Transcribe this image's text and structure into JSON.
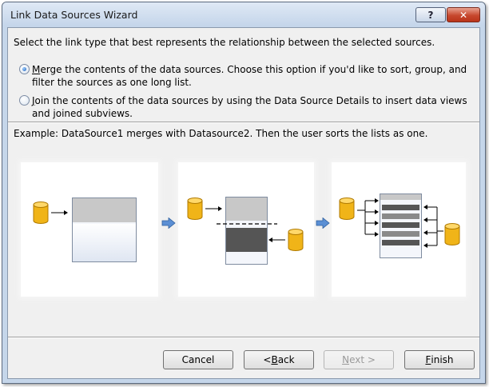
{
  "window": {
    "title": "Link Data Sources Wizard"
  },
  "titlebar": {
    "help_label": "?",
    "close_label": "✕"
  },
  "instruction": "Select the link type that best represents the relationship between the selected sources.",
  "options": [
    {
      "selected": true,
      "access_key": "M",
      "label_rest": "erge the contents of the data sources. Choose this option if you'd like to sort, group, and filter the sources as one long list."
    },
    {
      "selected": false,
      "access_key": "J",
      "label_rest": "oin the contents of the data sources by using the Data Source Details to insert data views and joined subviews."
    }
  ],
  "example": "Example: DataSource1 merges with Datasource2. Then the user sorts the lists as one.",
  "buttons": {
    "cancel": "Cancel",
    "back_prefix": "< ",
    "back_key": "B",
    "back_rest": "ack",
    "next_key": "N",
    "next_rest": "ext >",
    "finish_key": "F",
    "finish_rest": "inish"
  },
  "colors": {
    "accent": "#1c5cb8",
    "database": "#f0b418",
    "title_bar": "#c4d5ea"
  }
}
